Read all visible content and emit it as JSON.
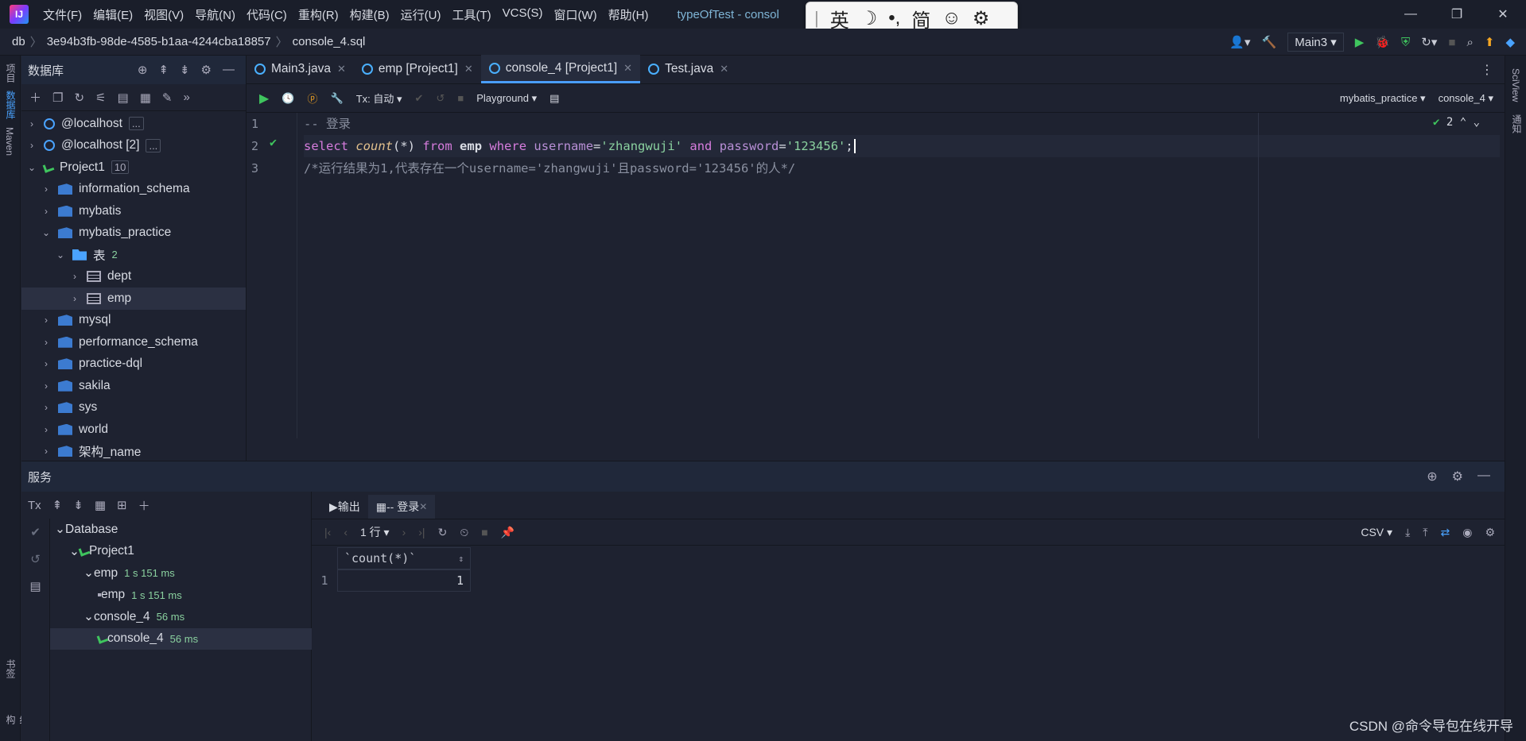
{
  "app": {
    "logo": "IJ",
    "title": "typeOfTest - consol",
    "menu": [
      "文件(F)",
      "编辑(E)",
      "视图(V)",
      "导航(N)",
      "代码(C)",
      "重构(R)",
      "构建(B)",
      "运行(U)",
      "工具(T)",
      "VCS(S)",
      "窗口(W)",
      "帮助(H)"
    ]
  },
  "ime": {
    "items": [
      "英",
      "☽",
      "•,",
      "简",
      "☺",
      "⚙"
    ]
  },
  "window_controls": [
    "—",
    "❐",
    "✕"
  ],
  "breadcrumb": [
    "db",
    "3e94b3fb-98de-4585-b1aa-4244cba18857",
    "console_4.sql"
  ],
  "run_config": "Main3",
  "db_panel": {
    "title": "数据库",
    "tree": [
      {
        "label": "@localhost",
        "level": 0,
        "arrow": "›",
        "icon": "host",
        "badge": "..."
      },
      {
        "label": "@localhost [2]",
        "level": 0,
        "arrow": "›",
        "icon": "host",
        "badge": "..."
      },
      {
        "label": "Project1",
        "level": 0,
        "arrow": "⌄",
        "icon": "proj",
        "badge": "10"
      },
      {
        "label": "information_schema",
        "level": 1,
        "arrow": "›",
        "icon": "db"
      },
      {
        "label": "mybatis",
        "level": 1,
        "arrow": "›",
        "icon": "db"
      },
      {
        "label": "mybatis_practice",
        "level": 1,
        "arrow": "⌄",
        "icon": "db"
      },
      {
        "label": "表",
        "level": 2,
        "arrow": "⌄",
        "icon": "folder",
        "count": "2"
      },
      {
        "label": "dept",
        "level": 3,
        "arrow": "›",
        "icon": "table"
      },
      {
        "label": "emp",
        "level": 3,
        "arrow": "›",
        "icon": "table",
        "selected": true
      },
      {
        "label": "mysql",
        "level": 1,
        "arrow": "›",
        "icon": "db"
      },
      {
        "label": "performance_schema",
        "level": 1,
        "arrow": "›",
        "icon": "db"
      },
      {
        "label": "practice-dql",
        "level": 1,
        "arrow": "›",
        "icon": "db"
      },
      {
        "label": "sakila",
        "level": 1,
        "arrow": "›",
        "icon": "db"
      },
      {
        "label": "sys",
        "level": 1,
        "arrow": "›",
        "icon": "db"
      },
      {
        "label": "world",
        "level": 1,
        "arrow": "›",
        "icon": "db"
      },
      {
        "label": "架构_name",
        "level": 1,
        "arrow": "›",
        "icon": "db"
      }
    ]
  },
  "editor": {
    "tabs": [
      {
        "label": "Main3.java",
        "active": false
      },
      {
        "label": "emp [Project1]",
        "active": false
      },
      {
        "label": "console_4 [Project1]",
        "active": true
      },
      {
        "label": "Test.java",
        "active": false
      }
    ],
    "toolbar": {
      "tx": "Tx: 自动",
      "playground": "Playground",
      "schema": "mybatis_practice",
      "console": "console_4"
    },
    "line_numbers": [
      "1",
      "2",
      "3"
    ],
    "check_count": "2",
    "line1": "-- 登录",
    "line2": {
      "kw1": "select",
      "fn": "count",
      "args": "(*)",
      "kw2": "from",
      "tbl": "emp",
      "kw3": "where",
      "c1": "username",
      "s1": "'zhangwuji'",
      "kw4": "and",
      "c2": "password",
      "s2": "'123456'",
      "end": ";"
    },
    "line3": "/*运行结果为1,代表存在一个username='zhangwuji'且password='123456'的人*/"
  },
  "services": {
    "title": "服务",
    "tree": [
      {
        "label": "Database",
        "level": 0,
        "arrow": "⌄",
        "icon": "folder"
      },
      {
        "label": "Project1",
        "level": 1,
        "arrow": "⌄",
        "icon": "proj"
      },
      {
        "label": "emp",
        "level": 2,
        "arrow": "⌄",
        "icon": "db",
        "time": "1 s 151 ms"
      },
      {
        "label": "emp",
        "level": 3,
        "arrow": "",
        "icon": "table",
        "time": "1 s 151 ms"
      },
      {
        "label": "console_4",
        "level": 2,
        "arrow": "⌄",
        "icon": "db",
        "time": "56 ms"
      },
      {
        "label": "console_4",
        "level": 3,
        "arrow": "",
        "icon": "proj",
        "time": "56 ms",
        "selected": true
      }
    ],
    "tabs": [
      {
        "label": "输出",
        "active": false
      },
      {
        "label": "-- 登录",
        "active": true
      }
    ],
    "rows_label": "1 行",
    "export": "CSV",
    "result": {
      "column": "`count(*)`",
      "rows": [
        {
          "n": "1",
          "v": "1"
        }
      ]
    }
  },
  "watermark": "CSDN @命令导包在线开导"
}
